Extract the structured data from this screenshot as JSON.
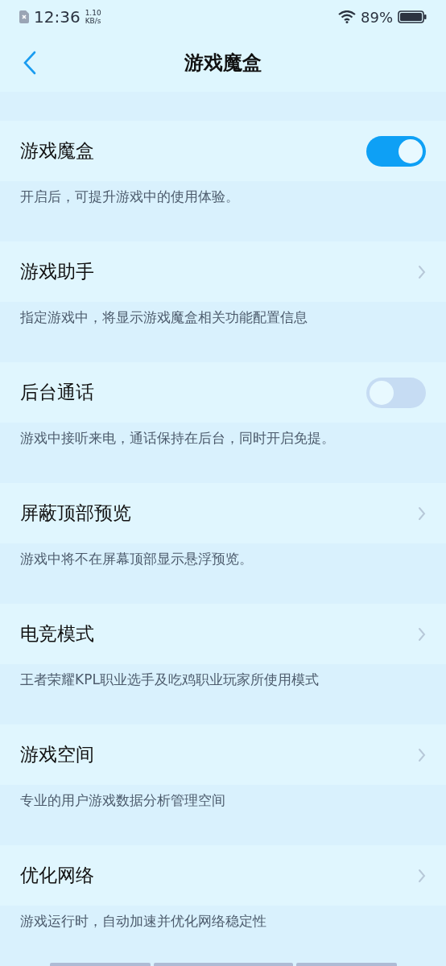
{
  "status_bar": {
    "time": "12:36",
    "speed_value": "1.10",
    "speed_unit": "KB/s",
    "battery": "89%"
  },
  "header": {
    "title": "游戏魔盒"
  },
  "settings": [
    {
      "kind": "toggle",
      "title": "游戏魔盒",
      "on": true,
      "description": "开启后，可提升游戏中的使用体验。"
    },
    {
      "kind": "link",
      "title": "游戏助手",
      "description": "指定游戏中，将显示游戏魔盒相关功能配置信息"
    },
    {
      "kind": "toggle",
      "title": "后台通话",
      "on": false,
      "description": "游戏中接听来电，通话保持在后台，同时开启免提。"
    },
    {
      "kind": "link",
      "title": "屏蔽顶部预览",
      "description": "游戏中将不在屏幕顶部显示悬浮预览。"
    },
    {
      "kind": "link",
      "title": "电竞模式",
      "description": "王者荣耀KPL职业选手及吃鸡职业玩家所使用模式"
    },
    {
      "kind": "link",
      "title": "游戏空间",
      "description": "专业的用户游戏数据分析管理空间"
    },
    {
      "kind": "link",
      "title": "优化网络",
      "description": "游戏运行时，自动加速并优化网络稳定性"
    }
  ]
}
